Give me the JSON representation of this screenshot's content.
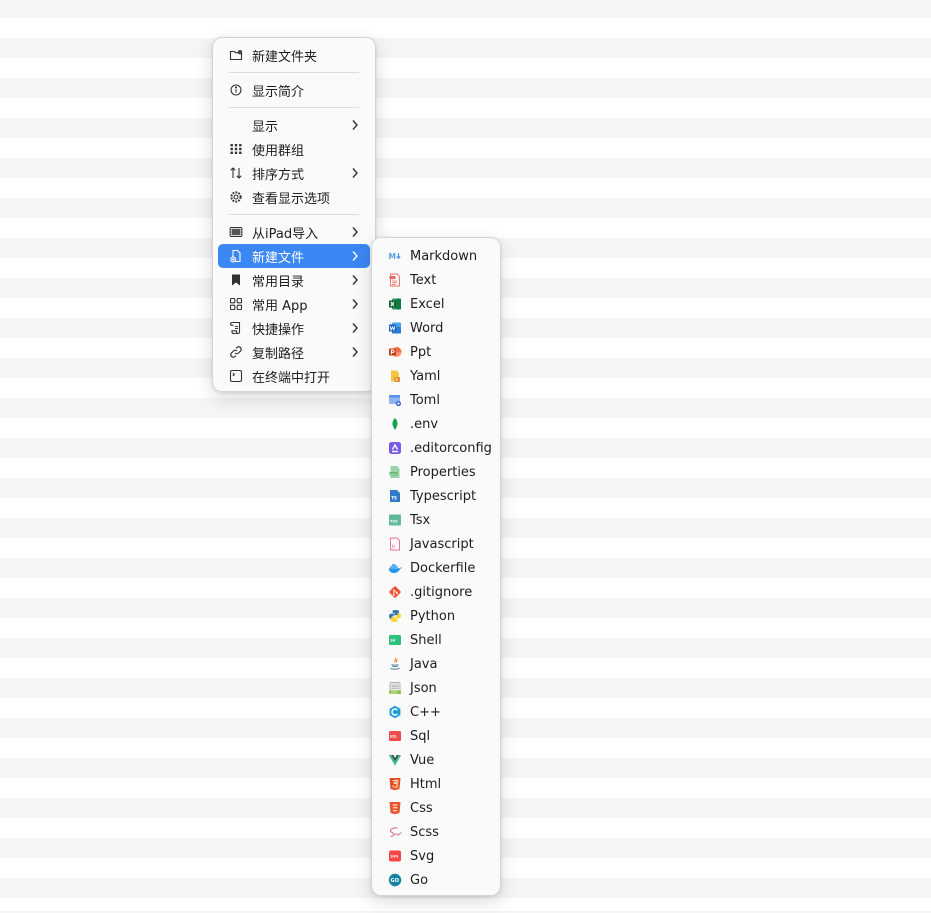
{
  "main_menu": {
    "new_folder": "新建文件夹",
    "get_info": "显示简介",
    "show": "显示",
    "use_groups": "使用群组",
    "sort_by": "排序方式",
    "view_options": "查看显示选项",
    "import_ipad": "从iPad导入",
    "new_file": "新建文件",
    "favorites": "常用目录",
    "common_app": "常用 App",
    "quick_actions": "快捷操作",
    "copy_path": "复制路径",
    "open_terminal": "在终端中打开"
  },
  "submenu": {
    "items": [
      {
        "label": "Markdown",
        "icon": "markdown-icon"
      },
      {
        "label": "Text",
        "icon": "text-file-icon"
      },
      {
        "label": "Excel",
        "icon": "excel-icon"
      },
      {
        "label": "Word",
        "icon": "word-icon"
      },
      {
        "label": "Ppt",
        "icon": "powerpoint-icon"
      },
      {
        "label": "Yaml",
        "icon": "yaml-icon"
      },
      {
        "label": "Toml",
        "icon": "toml-icon"
      },
      {
        "label": ".env",
        "icon": "env-leaf-icon"
      },
      {
        "label": ".editorconfig",
        "icon": "editorconfig-icon"
      },
      {
        "label": "Properties",
        "icon": "properties-icon"
      },
      {
        "label": "Typescript",
        "icon": "typescript-icon"
      },
      {
        "label": "Tsx",
        "icon": "tsx-icon"
      },
      {
        "label": "Javascript",
        "icon": "javascript-icon"
      },
      {
        "label": "Dockerfile",
        "icon": "docker-icon"
      },
      {
        "label": ".gitignore",
        "icon": "git-icon"
      },
      {
        "label": "Python",
        "icon": "python-icon"
      },
      {
        "label": "Shell",
        "icon": "shell-icon"
      },
      {
        "label": "Java",
        "icon": "java-icon"
      },
      {
        "label": "Json",
        "icon": "json-icon"
      },
      {
        "label": "C++",
        "icon": "cpp-icon"
      },
      {
        "label": "Sql",
        "icon": "sql-icon"
      },
      {
        "label": "Vue",
        "icon": "vue-icon"
      },
      {
        "label": "Html",
        "icon": "html5-icon"
      },
      {
        "label": "Css",
        "icon": "css3-icon"
      },
      {
        "label": "Scss",
        "icon": "sass-icon"
      },
      {
        "label": "Svg",
        "icon": "svg-icon"
      },
      {
        "label": "Go",
        "icon": "go-icon"
      }
    ]
  },
  "colors": {
    "highlight": "#3b87f3",
    "stripe": "#f4f5f4"
  }
}
